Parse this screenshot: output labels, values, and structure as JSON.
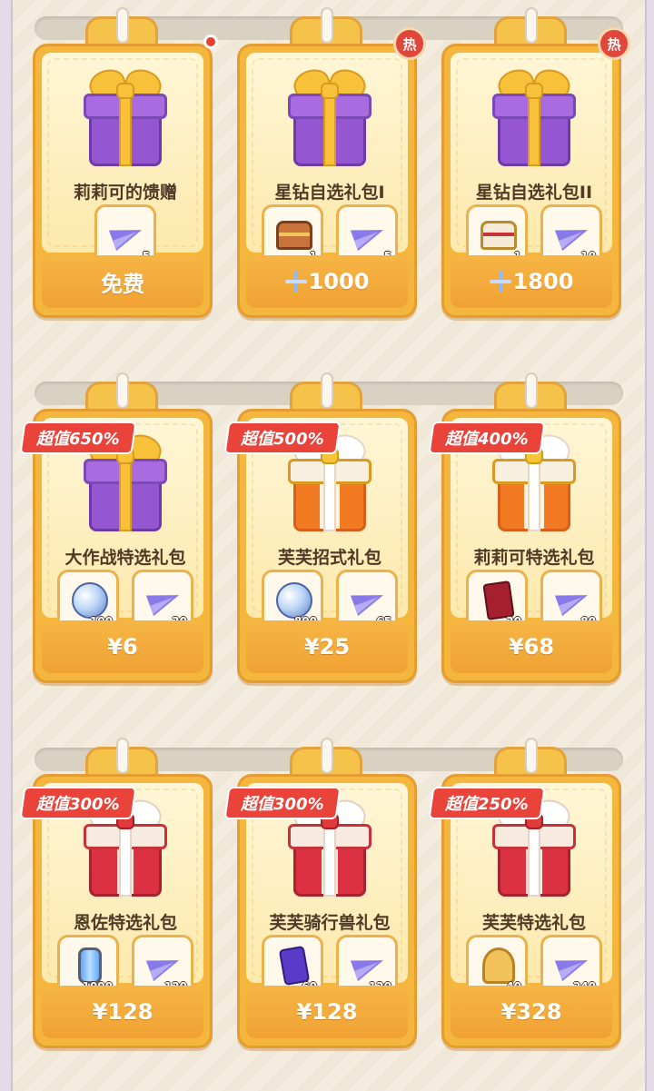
{
  "rows": [
    {
      "cards": [
        {
          "name": "莉莉可的馈赠",
          "gift": "purple",
          "badge": "dot",
          "price_label": "免费",
          "currency": "none",
          "items": [
            {
              "icon": "paper-plane-icon",
              "qty": "5"
            }
          ]
        },
        {
          "name": "星钻自选礼包I",
          "gift": "purple",
          "badge": "热",
          "price_label": "1000",
          "currency": "star-diamond",
          "items": [
            {
              "icon": "treasure-chest-icon",
              "qty": "1"
            },
            {
              "icon": "paper-plane-icon",
              "qty": "5"
            }
          ]
        },
        {
          "name": "星钻自选礼包II",
          "gift": "purple",
          "badge": "热",
          "price_label": "1800",
          "currency": "star-diamond",
          "items": [
            {
              "icon": "gold-chest-icon",
              "qty": "1"
            },
            {
              "icon": "paper-plane-icon",
              "qty": "10"
            }
          ]
        }
      ]
    },
    {
      "cards": [
        {
          "name": "大作战特选礼包",
          "gift": "purple",
          "ribbon": "超值650%",
          "price_label": "¥6",
          "items": [
            {
              "icon": "crystal-orb-icon",
              "qty": "100"
            },
            {
              "icon": "paper-plane-icon",
              "qty": "20"
            }
          ]
        },
        {
          "name": "芙芙招式礼包",
          "gift": "orange",
          "ribbon": "超值500%",
          "price_label": "¥25",
          "items": [
            {
              "icon": "crystal-orb-icon",
              "qty": "800"
            },
            {
              "icon": "paper-plane-icon",
              "qty": "65"
            }
          ]
        },
        {
          "name": "莉莉可特选礼包",
          "gift": "orange",
          "ribbon": "超值400%",
          "price_label": "¥68",
          "items": [
            {
              "icon": "red-card-icon",
              "qty": "20"
            },
            {
              "icon": "paper-plane-icon",
              "qty": "80"
            }
          ]
        }
      ]
    },
    {
      "cards": [
        {
          "name": "恩佐特选礼包",
          "gift": "red",
          "ribbon": "超值300%",
          "price_label": "¥128",
          "items": [
            {
              "icon": "energy-cylinder-icon",
              "qty": "1000"
            },
            {
              "icon": "paper-plane-icon",
              "qty": "120"
            }
          ]
        },
        {
          "name": "芙芙骑行兽礼包",
          "gift": "red",
          "ribbon": "超值300%",
          "price_label": "¥128",
          "items": [
            {
              "icon": "mount-ticket-icon",
              "qty": "60"
            },
            {
              "icon": "paper-plane-icon",
              "qty": "120"
            }
          ]
        },
        {
          "name": "芙芙特选礼包",
          "gift": "red",
          "ribbon": "超值250%",
          "price_label": "¥328",
          "items": [
            {
              "icon": "lyre-icon",
              "qty": "40"
            },
            {
              "icon": "paper-plane-icon",
              "qty": "240"
            }
          ]
        }
      ]
    }
  ],
  "colors": {
    "card_gold": "#f4b63c",
    "ribbon_red": "#e9433a",
    "name_brown": "#4f3a26"
  }
}
